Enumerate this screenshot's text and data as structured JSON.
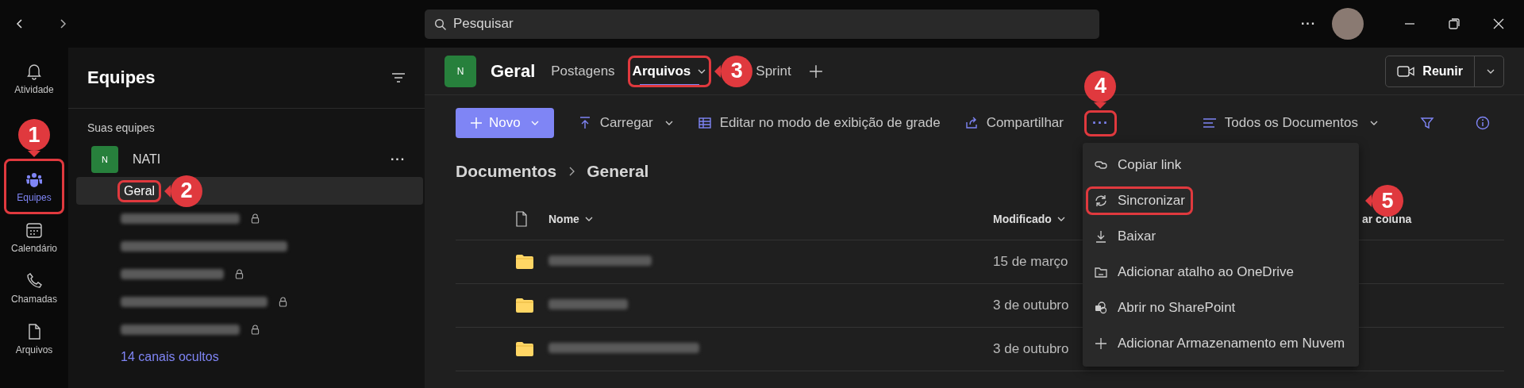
{
  "title_bar": {
    "search": {
      "placeholder": "Pesquisar"
    },
    "more": "···"
  },
  "rail": [
    {
      "kind": "activity",
      "label": "Atividade",
      "selected": false
    },
    {
      "kind": "teams",
      "label": "Equipes",
      "selected": true,
      "callout": "1"
    },
    {
      "kind": "calendar",
      "label": "Calendário",
      "selected": false
    },
    {
      "kind": "calls",
      "label": "Chamadas",
      "selected": false
    },
    {
      "kind": "files",
      "label": "Arquivos",
      "selected": false
    }
  ],
  "teams_panel": {
    "title": "Equipes",
    "section": "Suas equipes",
    "team": {
      "avatar": "N",
      "name": "NATI",
      "more": "···"
    },
    "channels": [
      {
        "name": "Geral",
        "selected": true,
        "callout": "2"
      },
      {
        "locked": true,
        "selected": false
      },
      {
        "locked": false,
        "selected": false
      },
      {
        "locked": true,
        "selected": false
      },
      {
        "locked": true,
        "selected": false
      },
      {
        "locked": true,
        "selected": false
      }
    ],
    "hidden_link": "14 canais ocultos"
  },
  "channel_header": {
    "avatar": "N",
    "title": "Geral",
    "tabs": [
      {
        "label": "Postagens",
        "selected": false,
        "dropdown": false
      },
      {
        "label": "Arquivos",
        "selected": true,
        "dropdown": true,
        "callout": "3"
      },
      {
        "label": "Sprint",
        "selected": false,
        "dropdown": false
      }
    ],
    "meet_button": "Reunir"
  },
  "toolbar": {
    "items": [
      {
        "kind": "new",
        "label": "Novo",
        "dropdown": true
      },
      {
        "kind": "upload",
        "label": "Carregar",
        "dropdown": true
      },
      {
        "kind": "grid",
        "label": "Editar no modo de exibição de grade",
        "dropdown": false
      },
      {
        "kind": "share",
        "label": "Compartilhar",
        "dropdown": false
      },
      {
        "kind": "more",
        "label": "···",
        "dropdown": false,
        "callout": "4"
      }
    ],
    "view": "Todos os Documentos"
  },
  "menu": [
    {
      "kind": "link",
      "label": "Copiar link"
    },
    {
      "kind": "sync",
      "label": "Sincronizar",
      "callout": "5"
    },
    {
      "kind": "download",
      "label": "Baixar"
    },
    {
      "kind": "shortcut",
      "label": "Adicionar atalho ao OneDrive"
    },
    {
      "kind": "sharepoint",
      "label": "Abrir no SharePoint"
    },
    {
      "kind": "add",
      "label": "Adicionar Armazenamento em Nuvem"
    }
  ],
  "breadcrumb": [
    "Documentos",
    "General"
  ],
  "table": {
    "columns": [
      "Nome",
      "Modificado",
      "ar coluna"
    ],
    "rows": [
      {
        "modified": "15 de março"
      },
      {
        "modified": "3 de outubro"
      },
      {
        "modified": "3 de outubro"
      }
    ]
  }
}
